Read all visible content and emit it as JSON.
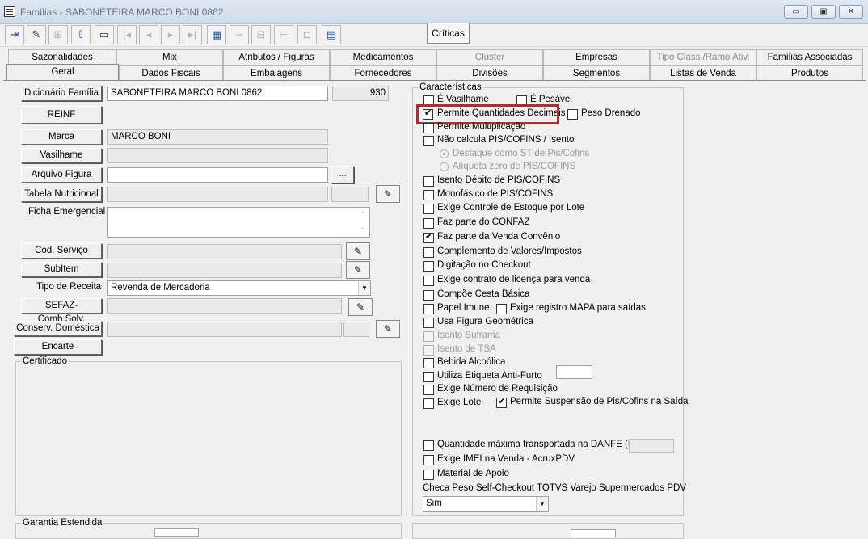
{
  "window": {
    "title": "Famílias - SABONETEIRA MARCO BONI 0862",
    "minimize_label": "▭",
    "maximize_label": "▣",
    "close_label": "✕"
  },
  "toolbar": {
    "criticas_label": "Críticas"
  },
  "tabs_row1": [
    "Sazonalidades",
    "Mix",
    "Atributos / Figuras",
    "Medicamentos",
    "Cluster",
    "Empresas",
    "Tipo Class./Ramo Ativ.",
    "Famílias Associadas"
  ],
  "tabs_row2": [
    "Geral",
    "Dados Fiscais",
    "Embalagens",
    "Fornecedores",
    "Divisões",
    "Segmentos",
    "Listas de Venda",
    "Produtos"
  ],
  "left": {
    "dicionario_familia_label": "Dicionário Família",
    "dicionario_familia_value": "SABONETEIRA MARCO BONI 0862",
    "dicionario_familia_code": "930",
    "reinf_label": "REINF",
    "marca_label": "Marca",
    "marca_value": "MARCO BONI",
    "vasilhame_label": "Vasilhame",
    "arquivo_figura_label": "Arquivo Figura",
    "browse_label": "...",
    "tabela_nutricional_label": "Tabela Nutricional",
    "ficha_emergencial_label": "Ficha Emergencial",
    "cod_servico_label": "Cód. Serviço",
    "subitem_label": "SubItem",
    "tipo_receita_label": "Tipo de Receita",
    "tipo_receita_value": "Revenda de Mercadoria",
    "sefaz_label": "SEFAZ-Comb.Solv.",
    "conserv_label": "Conserv. Doméstica",
    "encarte_label": "Encarte",
    "certificado_label": "Certificado",
    "garantia_label": "Garantia Estendida"
  },
  "caracteristicas": {
    "title": "Características",
    "e_vasilhame": "É Vasilhame",
    "e_pesavel": "É Pesável",
    "permite_qtd_decimais": "Permite Quantidades Decimais",
    "peso_drenado": "Peso Drenado",
    "permite_multiplicacao": "Permite Multiplicação",
    "nao_calcula_pis": "Não calcula PIS/COFINS / Isento",
    "destaque_st": "Destaque como ST de Pis/Cofins",
    "aliquota_zero": "Alíquota zero de PIS/COFINS",
    "isento_debito": "Isento Débito de PIS/COFINS",
    "monofasico": "Monofásico de PIS/COFINS",
    "exige_estoque_lote": "Exige Controle de Estoque por Lote",
    "faz_parte_confaz": "Faz parte do CONFAZ",
    "faz_parte_convenio": "Faz parte da Venda Convênio",
    "complemento_valores": "Complemento de Valores/Impostos",
    "digitacao_checkout": "Digitação no Checkout",
    "exige_licenca": "Exige contrato de licença para venda",
    "compoe_cesta": "Compõe Cesta Básica",
    "papel_imune": "Papel Imune",
    "exige_mapa": "Exige registro MAPA para saídas",
    "usa_figura": "Usa Figura Geométrica",
    "isento_suframa": "Isento Suframa",
    "isento_tsa": "Isento de TSA",
    "bebida_alcoolica": "Bebida Alcoólica",
    "etiqueta_antifurto": "Utiliza Etiqueta Anti-Furto",
    "exige_num_requisicao": "Exige Número de Requisição",
    "exige_lote": "Exige Lote",
    "permite_suspensao": "Permite Suspensão de Pis/Cofins na Saída",
    "qtd_max_danfe": "Quantidade máxima transportada na DANFE (KG)",
    "exige_imei": "Exige IMEI na Venda - AcruxPDV",
    "material_apoio": "Material de Apoio",
    "checa_peso_label": "Checa Peso Self-Checkout TOTVS Varejo Supermercados PDV",
    "checa_peso_value": "Sim"
  }
}
